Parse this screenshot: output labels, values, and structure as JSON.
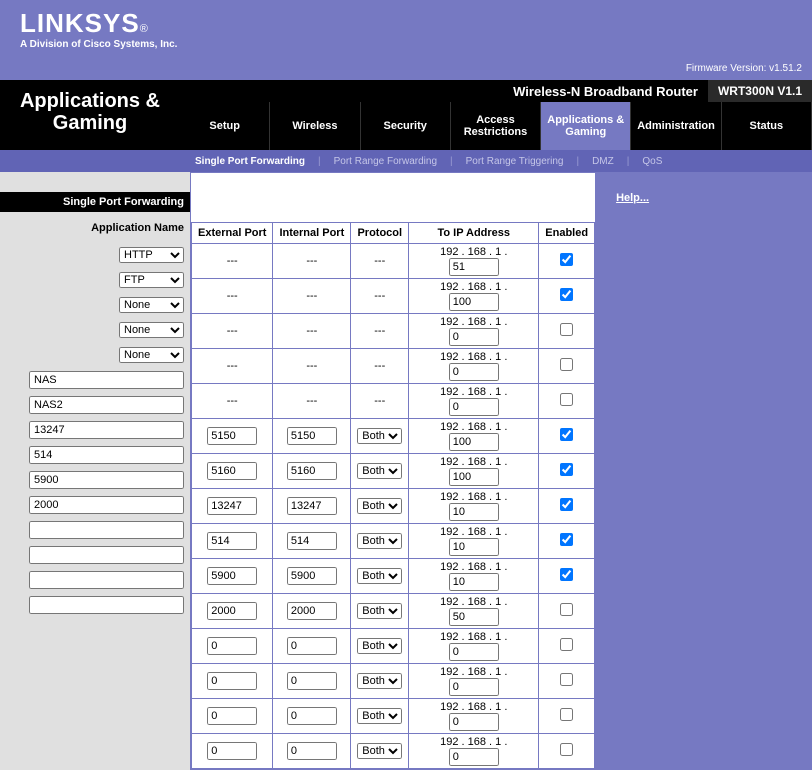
{
  "top": {
    "brand": "LINKSYS",
    "reg": "®",
    "sub": "A Division of Cisco Systems, Inc.",
    "fw": "Firmware Version: v1.51.2"
  },
  "bar": {
    "model_txt": "Wireless-N Broadband Router",
    "model_num": "WRT300N V1.1",
    "title": "Applications & Gaming"
  },
  "tabs": [
    "Setup",
    "Wireless",
    "Security",
    "Access Restrictions",
    "Applications & Gaming",
    "Administration",
    "Status"
  ],
  "activeTab": 4,
  "subnav": [
    "Single Port Forwarding",
    "Port Range Forwarding",
    "Port Range Triggering",
    "DMZ",
    "QoS"
  ],
  "activeSub": 0,
  "left": {
    "hdr": "Single Port Forwarding",
    "sub": "Application Name"
  },
  "th": {
    "ext": "External Port",
    "int": "Internal Port",
    "proto": "Protocol",
    "ip": "To IP Address",
    "en": "Enabled"
  },
  "select_opts": [
    "HTTP",
    "FTP",
    "None"
  ],
  "proto_opts": [
    "Both"
  ],
  "ip_prefix": "192 . 168 . 1 .",
  "help": "Help...",
  "preset": [
    {
      "sel": "HTTP",
      "ip": "51",
      "en": true
    },
    {
      "sel": "FTP",
      "ip": "100",
      "en": true
    },
    {
      "sel": "None",
      "ip": "0",
      "en": false
    },
    {
      "sel": "None",
      "ip": "0",
      "en": false
    },
    {
      "sel": "None",
      "ip": "0",
      "en": false
    }
  ],
  "custom": [
    {
      "name": "NAS",
      "ext": "5150",
      "int": "5150",
      "proto": "Both",
      "ip": "100",
      "en": true
    },
    {
      "name": "NAS2",
      "ext": "5160",
      "int": "5160",
      "proto": "Both",
      "ip": "100",
      "en": true
    },
    {
      "name": "13247",
      "ext": "13247",
      "int": "13247",
      "proto": "Both",
      "ip": "10",
      "en": true
    },
    {
      "name": "514",
      "ext": "514",
      "int": "514",
      "proto": "Both",
      "ip": "10",
      "en": true
    },
    {
      "name": "5900",
      "ext": "5900",
      "int": "5900",
      "proto": "Both",
      "ip": "10",
      "en": true
    },
    {
      "name": "2000",
      "ext": "2000",
      "int": "2000",
      "proto": "Both",
      "ip": "50",
      "en": false
    },
    {
      "name": "",
      "ext": "0",
      "int": "0",
      "proto": "Both",
      "ip": "0",
      "en": false
    },
    {
      "name": "",
      "ext": "0",
      "int": "0",
      "proto": "Both",
      "ip": "0",
      "en": false
    },
    {
      "name": "",
      "ext": "0",
      "int": "0",
      "proto": "Both",
      "ip": "0",
      "en": false
    },
    {
      "name": "",
      "ext": "0",
      "int": "0",
      "proto": "Both",
      "ip": "0",
      "en": false
    }
  ]
}
